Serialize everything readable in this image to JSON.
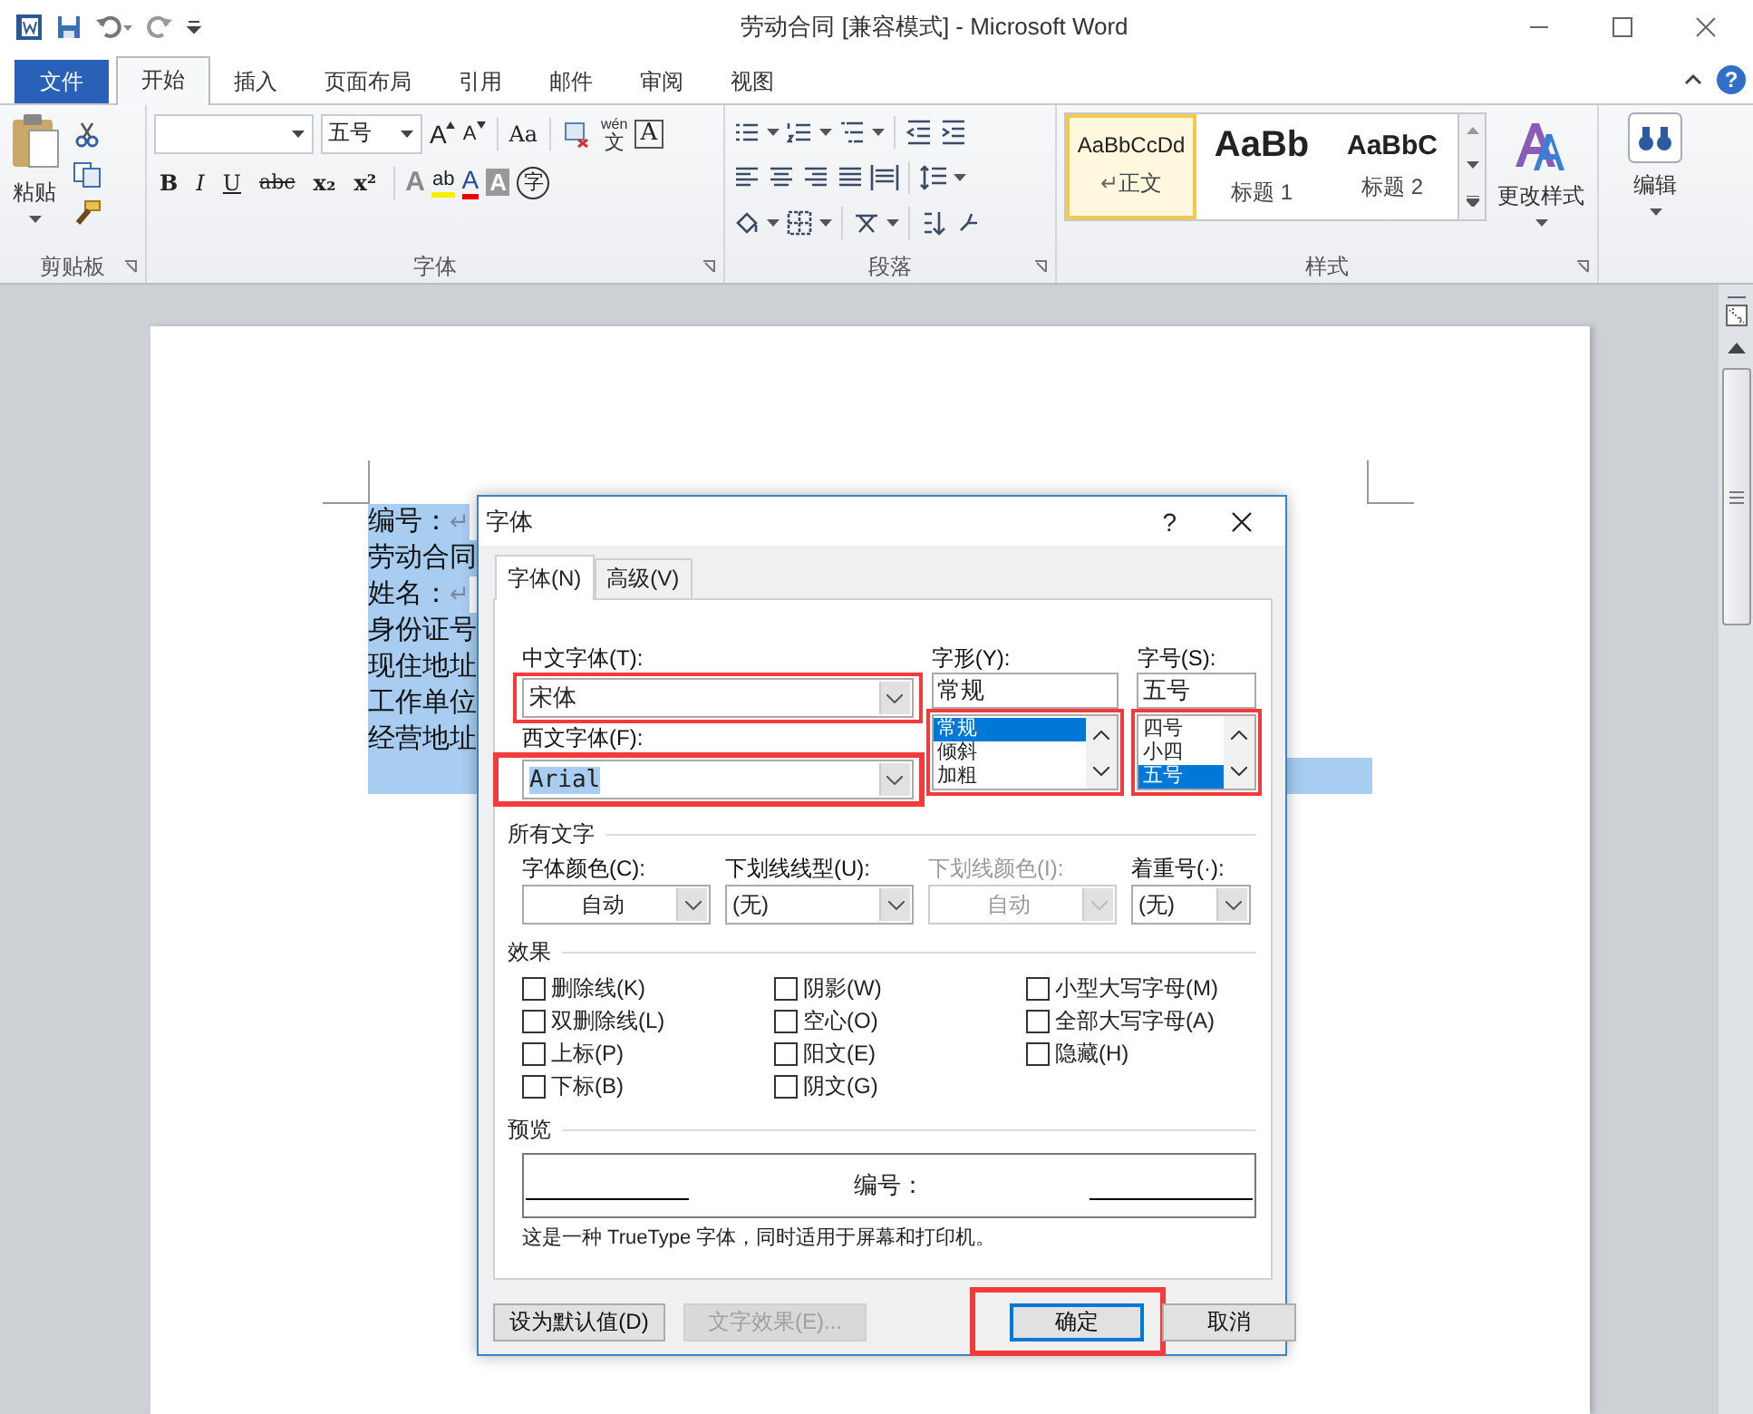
{
  "window": {
    "title": "劳动合同 [兼容模式] - Microsoft Word"
  },
  "ribbon_tabs": [
    {
      "label": "文件",
      "kind": "file",
      "selected": false
    },
    {
      "label": "开始",
      "kind": "tab",
      "selected": true
    },
    {
      "label": "插入",
      "kind": "tab",
      "selected": false
    },
    {
      "label": "页面布局",
      "kind": "tab",
      "selected": false
    },
    {
      "label": "引用",
      "kind": "tab",
      "selected": false
    },
    {
      "label": "邮件",
      "kind": "tab",
      "selected": false
    },
    {
      "label": "审阅",
      "kind": "tab",
      "selected": false
    },
    {
      "label": "视图",
      "kind": "tab",
      "selected": false
    }
  ],
  "help": "?",
  "clipboard": {
    "paste": "粘贴",
    "label": "剪贴板"
  },
  "font_group": {
    "size": "五号",
    "grow": "A",
    "shrink": "A",
    "case": "Aa",
    "phonetic": "wén",
    "phonetic_base": "文",
    "border_char": "A",
    "format": [
      "B",
      "I",
      "U",
      "abc",
      "x₂",
      "x²"
    ],
    "effect": "A",
    "highlight": "ab",
    "font_color": "A",
    "shading": "A",
    "enclose": "字",
    "label": "字体"
  },
  "paragraph_group": {
    "label": "段落"
  },
  "styles": {
    "items": [
      {
        "sample": "AaBbCcDd",
        "name": "正文",
        "end_mark": "↵",
        "selected": true
      },
      {
        "sample": "AaBb",
        "name": "标题 1",
        "selected": false
      },
      {
        "sample": "AaBbC",
        "name": "标题 2",
        "selected": false
      }
    ],
    "change": "更改样式",
    "label": "样式"
  },
  "editing": {
    "label": "编辑"
  },
  "document": {
    "lines": [
      {
        "text": "编号：",
        "end_mark": "↵",
        "selected": true
      },
      {
        "text": "劳动合同",
        "selected": true
      },
      {
        "text": "姓名：",
        "end_mark": "↵",
        "selected": true
      },
      {
        "text": "身份证号",
        "selected": true
      },
      {
        "text": "现住地址",
        "selected": true
      },
      {
        "text": "工作单位",
        "selected": true
      },
      {
        "text": "经营地址",
        "selected": true
      },
      {
        "selected": true
      }
    ]
  },
  "dialog": {
    "title": "字体",
    "help": "?",
    "tabs": [
      {
        "label": "字体(N)",
        "selected": true
      },
      {
        "label": "高级(V)",
        "selected": false
      }
    ],
    "chinese_font": {
      "label": "中文字体(T):",
      "value": "宋体",
      "marked": true
    },
    "western_font": {
      "label": "西文字体(F):",
      "value": "Arial",
      "marked": true
    },
    "style": {
      "label": "字形(Y):",
      "value": "常规",
      "marked": true,
      "options": [
        {
          "label": "常规",
          "selected": true
        },
        {
          "label": "倾斜",
          "selected": false
        },
        {
          "label": "加粗",
          "selected": false
        }
      ]
    },
    "size": {
      "label": "字号(S):",
      "value": "五号",
      "marked": true,
      "options": [
        {
          "label": "四号",
          "selected": false
        },
        {
          "label": "小四",
          "selected": false
        },
        {
          "label": "五号",
          "selected": true
        }
      ]
    },
    "all_text": {
      "heading": "所有文字",
      "fields": [
        {
          "label": "字体颜色(C):",
          "value": "自动",
          "disabled": false
        },
        {
          "label": "下划线线型(U):",
          "value": "(无)",
          "disabled": false
        },
        {
          "label": "下划线颜色(I):",
          "value": "自动",
          "disabled": true
        },
        {
          "label": "着重号(·):",
          "value": "(无)",
          "disabled": false
        }
      ]
    },
    "effects": {
      "heading": "效果",
      "options": [
        {
          "label": "删除线(K)",
          "checked": false
        },
        {
          "label": "双删除线(L)",
          "checked": false
        },
        {
          "label": "上标(P)",
          "checked": false
        },
        {
          "label": "下标(B)",
          "checked": false
        },
        {
          "label": "阴影(W)",
          "checked": false
        },
        {
          "label": "空心(O)",
          "checked": false
        },
        {
          "label": "阳文(E)",
          "checked": false
        },
        {
          "label": "阴文(G)",
          "checked": false
        },
        {
          "label": "小型大写字母(M)",
          "checked": false
        },
        {
          "label": "全部大写字母(A)",
          "checked": false
        },
        {
          "label": "隐藏(H)",
          "checked": false
        }
      ]
    },
    "preview": {
      "heading": "预览",
      "sample": "编号：",
      "note": "这是一种 TrueType 字体，同时适用于屏幕和打印机。"
    },
    "buttons": [
      {
        "label": "设为默认值(D)",
        "disabled": false,
        "default": false,
        "marked": false
      },
      {
        "label": "文字效果(E)...",
        "disabled": true,
        "default": false,
        "marked": false
      },
      {
        "label": "确定",
        "disabled": false,
        "default": true,
        "marked": true
      },
      {
        "label": "取消",
        "disabled": false,
        "default": false,
        "marked": false
      }
    ]
  }
}
